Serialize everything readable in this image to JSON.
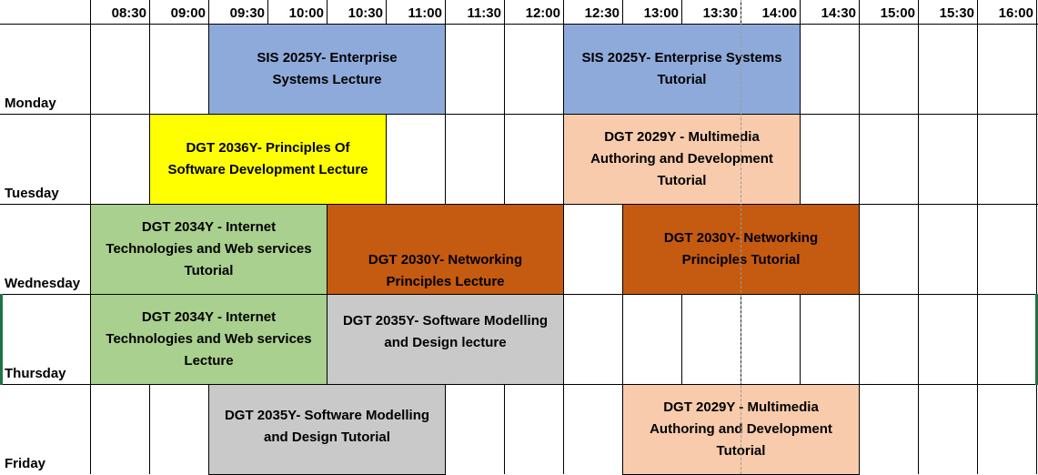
{
  "times": [
    "08:30",
    "09:00",
    "09:30",
    "10:00",
    "10:30",
    "11:00",
    "11:30",
    "12:00",
    "12:30",
    "13:00",
    "13:30",
    "14:00",
    "14:30",
    "15:00",
    "15:30",
    "16:00"
  ],
  "days": [
    "Monday",
    "Tuesday",
    "Wednesday",
    "Thursday",
    "Friday"
  ],
  "colors": {
    "blue": "#8eaadb",
    "yellow": "#ffff00",
    "peach": "#f8cbad",
    "green": "#a9d08e",
    "orange": "#c55a11",
    "gray": "#c9c9c9",
    "excel_green": "#217346"
  },
  "sessions": {
    "mon_sis_lecture": "SIS 2025Y- Enterprise Systems Lecture",
    "mon_sis_tutorial": "SIS 2025Y- Enterprise Systems Tutorial",
    "tue_dgt2036_lecture": "DGT 2036Y- Principles Of Software Development Lecture",
    "tue_dgt2029_tutorial": "DGT 2029Y - Multimedia Authoring and Development Tutorial",
    "wed_dgt2034_tutorial": "DGT 2034Y - Internet Technologies and Web services Tutorial",
    "wed_dgt2030_lecture": "DGT 2030Y- Networking Principles Lecture",
    "wed_dgt2030_tutorial": "DGT 2030Y- Networking Principles Tutorial",
    "thu_dgt2034_lecture": "DGT 2034Y - Internet Technologies and Web services Lecture",
    "thu_dgt2035_lecture": "DGT 2035Y- Software Modelling and Design lecture",
    "fri_dgt2035_tutorial": "DGT 2035Y- Software Modelling and Design Tutorial",
    "fri_dgt2029_tutorial": "DGT 2029Y - Multimedia Authoring and Development Tutorial"
  }
}
